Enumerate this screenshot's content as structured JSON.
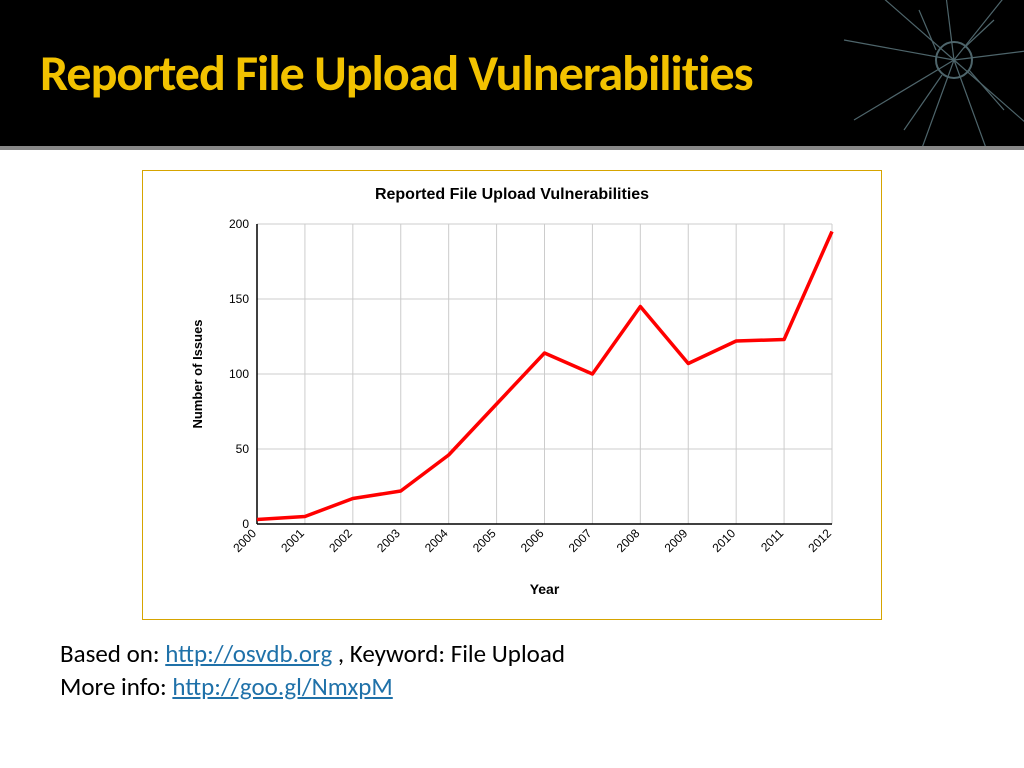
{
  "header": {
    "title": "Reported File Upload Vulnerabilities"
  },
  "footer": {
    "based_on_label": "Based on: ",
    "based_on_link": "http://osvdb.org",
    "based_on_suffix": " , Keyword: File Upload",
    "more_info_label": "More info: ",
    "more_info_link": "http://goo.gl/NmxpM"
  },
  "chart_data": {
    "type": "line",
    "title": "Reported File Upload Vulnerabilities",
    "xlabel": "Year",
    "ylabel": "Number of Issues",
    "categories": [
      "2000",
      "2001",
      "2002",
      "2003",
      "2004",
      "2005",
      "2006",
      "2007",
      "2008",
      "2009",
      "2010",
      "2011",
      "2012"
    ],
    "values": [
      3,
      5,
      17,
      22,
      46,
      80,
      114,
      100,
      145,
      107,
      122,
      123,
      195
    ],
    "ylim": [
      0,
      200
    ],
    "yticks": [
      0,
      50,
      100,
      150,
      200
    ],
    "grid": true,
    "line_color": "#ff0000"
  }
}
